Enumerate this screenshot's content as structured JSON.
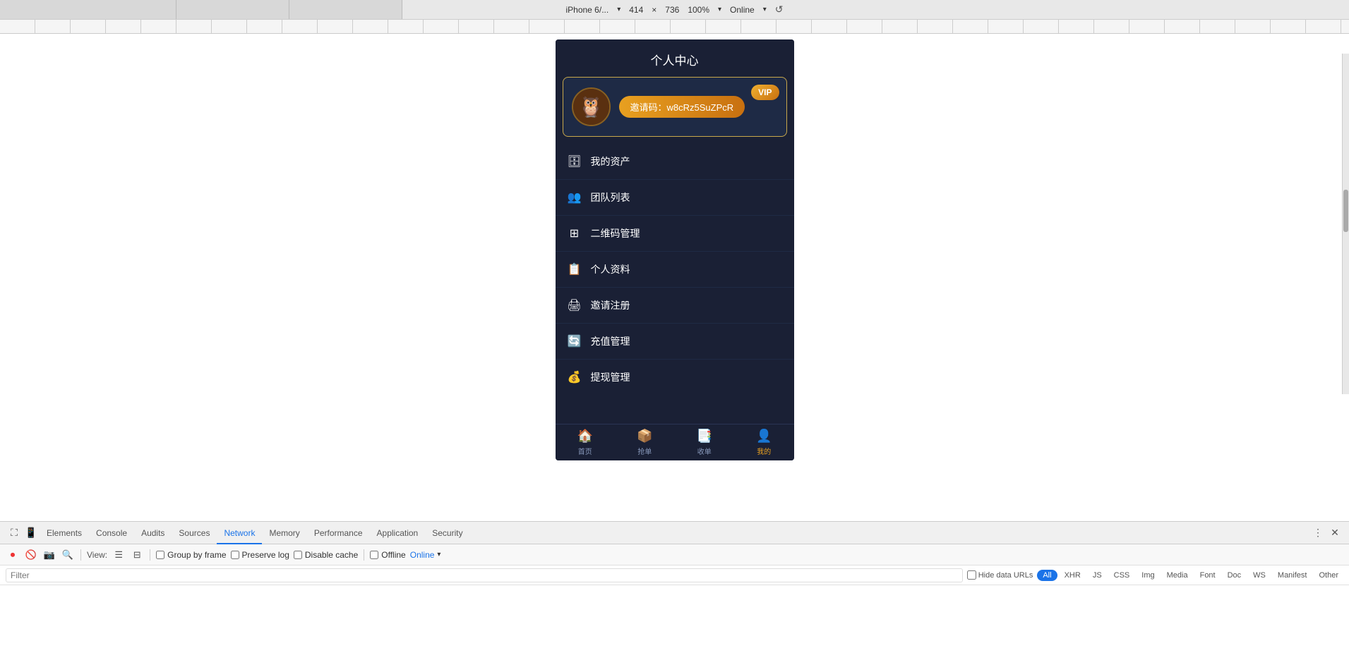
{
  "device_bar": {
    "device_name": "iPhone 6/...",
    "width": "414",
    "x_symbol": "×",
    "height": "736",
    "zoom": "100%",
    "network": "Online",
    "dropdown_arrow": "▾"
  },
  "phone": {
    "page_title": "个人中心",
    "profile_card": {
      "invite_label": "邀请码：w8cRz5SuZPcR",
      "vip_label": "VIP"
    },
    "menu_items": [
      {
        "icon": "🗄",
        "label": "我的资产"
      },
      {
        "icon": "👥",
        "label": "团队列表"
      },
      {
        "icon": "⊞",
        "label": "二维码管理"
      },
      {
        "icon": "📋",
        "label": "个人资料"
      },
      {
        "icon": "🖨",
        "label": "邀请注册"
      },
      {
        "icon": "🔄",
        "label": "充值管理"
      },
      {
        "icon": "💰",
        "label": "提现管理"
      }
    ],
    "tab_bar": [
      {
        "icon": "🏠",
        "label": "首页",
        "active": false
      },
      {
        "icon": "📦",
        "label": "抢单",
        "active": false
      },
      {
        "icon": "📑",
        "label": "收单",
        "active": false
      },
      {
        "icon": "👤",
        "label": "我的",
        "active": true
      }
    ]
  },
  "devtools": {
    "tabs": [
      {
        "label": "Elements",
        "active": false
      },
      {
        "label": "Console",
        "active": false
      },
      {
        "label": "Audits",
        "active": false
      },
      {
        "label": "Sources",
        "active": false
      },
      {
        "label": "Network",
        "active": true
      },
      {
        "label": "Memory",
        "active": false
      },
      {
        "label": "Performance",
        "active": false
      },
      {
        "label": "Application",
        "active": false
      },
      {
        "label": "Security",
        "active": false
      }
    ],
    "toolbar": {
      "view_label": "View:",
      "group_by_frame": "Group by frame",
      "preserve_log": "Preserve log",
      "disable_cache": "Disable cache",
      "offline": "Offline",
      "online": "Online"
    },
    "filter": {
      "placeholder": "Filter",
      "hide_data_urls": "Hide data URLs",
      "tags": [
        "All",
        "XHR",
        "JS",
        "CSS",
        "Img",
        "Media",
        "Font",
        "Doc",
        "WS",
        "Manifest",
        "Other"
      ]
    }
  }
}
